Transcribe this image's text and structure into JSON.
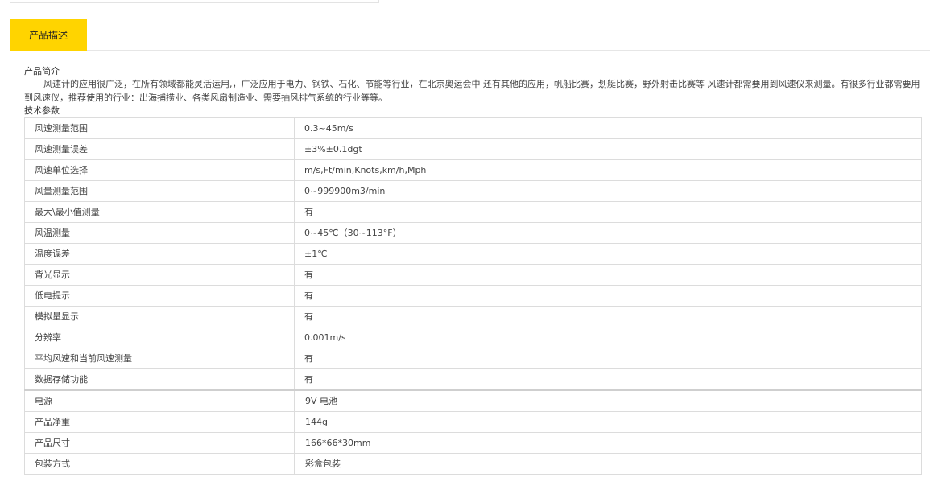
{
  "tabs": [
    {
      "label": "产品描述",
      "active": true
    }
  ],
  "intro": {
    "title": "产品简介",
    "text": "风速计的应用很广泛，在所有领域都能灵活运用,，广泛应用于电力、钢铁、石化、节能等行业，在北京奥运会中 还有其他的应用，帆船比赛，划艇比赛，野外射击比赛等 风速计都需要用到风速仪来测量。有很多行业都需要用到风速仪，推荐使用的行业：出海捕捞业、各类风扇制造业、需要抽风排气系统的行业等等。"
  },
  "specs": {
    "title": "技术参数",
    "rows": [
      {
        "label": "风速测量范围",
        "value": "0.3~45m/s"
      },
      {
        "label": "风速测量误差",
        "value": "±3%±0.1dgt"
      },
      {
        "label": "风速单位选择",
        "value": "m/s,Ft/min,Knots,km/h,Mph"
      },
      {
        "label": "风量测量范围",
        "value": "0~999900m3/min"
      },
      {
        "label": "最大\\最小值测量",
        "value": "有"
      },
      {
        "label": "风温测量",
        "value": "0~45℃（30~113°F）"
      },
      {
        "label": "温度误差",
        "value": "±1℃"
      },
      {
        "label": "背光显示",
        "value": "有"
      },
      {
        "label": "低电提示",
        "value": "有"
      },
      {
        "label": "模拟量显示",
        "value": "有"
      },
      {
        "label": "分辨率",
        "value": "0.001m/s"
      },
      {
        "label": "平均风速和当前风速测量",
        "value": "有"
      },
      {
        "label": "数据存储功能",
        "value": "有"
      },
      {
        "label": "电源",
        "value": "9V 电池"
      },
      {
        "label": "产品净重",
        "value": "144g"
      },
      {
        "label": "产品尺寸",
        "value": "166*66*30mm"
      },
      {
        "label": "包装方式",
        "value": "彩盒包装"
      }
    ]
  }
}
